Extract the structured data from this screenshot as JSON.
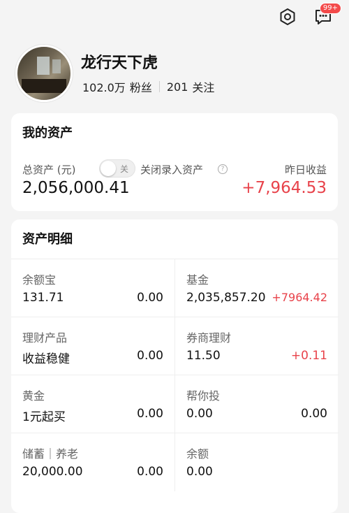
{
  "header": {
    "settings_icon": "hexagon-gear-icon",
    "message_icon": "chat-bubble-icon",
    "message_badge": "99+"
  },
  "profile": {
    "name": "龙行天下虎",
    "followers_value": "102.0万",
    "followers_label": "粉丝",
    "following_value": "201",
    "following_label": "关注"
  },
  "assets": {
    "title": "我的资产",
    "total_label": "总资产 (元)",
    "toggle_state": "关",
    "toggle_hint": "关闭录入资产",
    "total_value": "2,056,000.41",
    "yesterday_label": "昨日收益",
    "yesterday_value": "+7,964.53"
  },
  "detail": {
    "title": "资产明细",
    "items": [
      {
        "name": "余额宝",
        "value": "131.71",
        "income": "0.00",
        "income_positive": false
      },
      {
        "name": "基金",
        "value": "2,035,857.20",
        "income": "+7964.42",
        "income_positive": true
      },
      {
        "name": "理财产品",
        "value": "收益稳健",
        "income": "0.00",
        "income_positive": false
      },
      {
        "name": "券商理财",
        "value": "11.50",
        "income": "+0.11",
        "income_positive": true
      },
      {
        "name": "黄金",
        "value": "1元起买",
        "income": "0.00",
        "income_positive": false
      },
      {
        "name": "帮你投",
        "value": "0.00",
        "income": "0.00",
        "income_positive": false
      },
      {
        "name": "储蓄｜养老",
        "value": "20,000.00",
        "income": "0.00",
        "income_positive": false
      },
      {
        "name": "余额",
        "value": "0.00",
        "income": "",
        "income_positive": false
      }
    ]
  },
  "colors": {
    "positive": "#e8424a",
    "background": "#f4f4f4"
  }
}
